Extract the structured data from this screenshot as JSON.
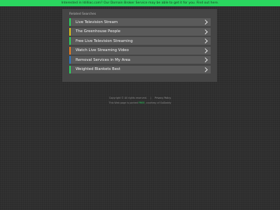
{
  "banner": {
    "text": "Interested in Idilliac.com? Our Domain Broker Service may be able to get it for you. Find out here.",
    "background": "#2ad65f"
  },
  "related": {
    "title": "Related Searches",
    "items": [
      {
        "label": "Live Television Stream",
        "accent": "#2ad65f"
      },
      {
        "label": "The Greenhouse People",
        "accent": "#e0c21a"
      },
      {
        "label": "Free Live Television Streaming",
        "accent": "#2ad65f"
      },
      {
        "label": "Watch Live Streaming Video",
        "accent": "#f07f1f"
      },
      {
        "label": "Removal Services in My Area",
        "accent": "#2a79c9"
      },
      {
        "label": "Weighted Blankets Best",
        "accent": "#2ad65f"
      }
    ],
    "arrow_icon": "chevron-right-icon"
  },
  "footer": {
    "copyright": "Copyright ©  All rights reserved.",
    "separator": "|",
    "privacy": "Privacy Policy",
    "line2_prefix": "This Web page is parked",
    "line2_link": "FREE",
    "line2_suffix": ", courtesy of GoDaddy"
  }
}
